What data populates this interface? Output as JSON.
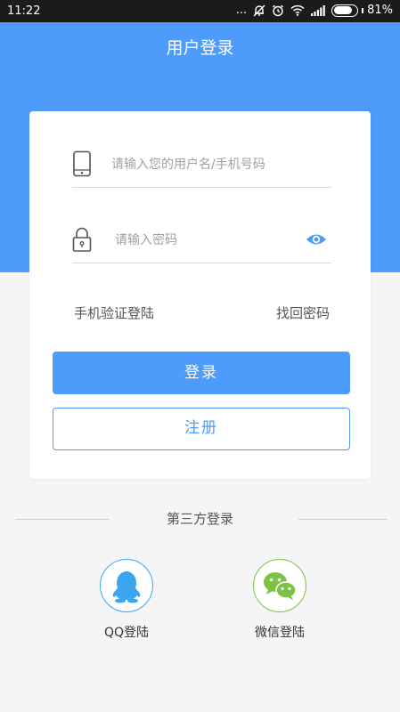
{
  "status_bar": {
    "time": "11:22",
    "dots": "...",
    "battery": "81%"
  },
  "header": {
    "title": "用户登录"
  },
  "form": {
    "username_placeholder": "请输入您的用户名/手机号码",
    "password_placeholder": "请输入密码",
    "sms_login": "手机验证登陆",
    "forgot_password": "找回密码",
    "login_button": "登录",
    "register_button": "注册"
  },
  "third_party": {
    "title": "第三方登录",
    "qq_label": "QQ登陆",
    "wechat_label": "微信登陆"
  },
  "colors": {
    "primary": "#4d9bfa",
    "status_bar": "#1b1b1b",
    "qq_blue": "#3aa6ef",
    "wechat_green": "#7dc242"
  },
  "icons": {
    "username": "phone-icon",
    "password": "lock-icon",
    "show_password": "eye-icon",
    "qq": "qq-penguin-icon",
    "wechat": "wechat-icon"
  }
}
